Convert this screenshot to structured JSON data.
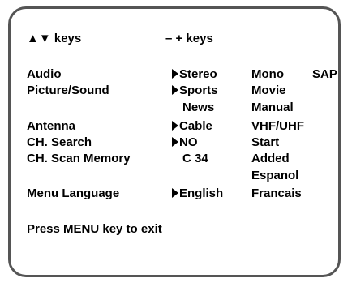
{
  "legend": {
    "updown_keys": "▲▼ keys",
    "plusminus_keys": "– + keys"
  },
  "menu": [
    {
      "id": "audio",
      "label": "Audio",
      "selected": "Stereo",
      "options": [
        "Mono",
        "SAP"
      ]
    },
    {
      "id": "picture-sound",
      "label": "Picture/Sound",
      "selected": "Sports",
      "options": [
        "Movie",
        "News",
        "Manual"
      ]
    },
    {
      "id": "antenna",
      "label": "Antenna",
      "selected": "Cable",
      "options": [
        "VHF/UHF"
      ]
    },
    {
      "id": "ch-search",
      "label": "CH. Search",
      "selected": "NO",
      "options": [
        "Start"
      ]
    },
    {
      "id": "ch-scan-memory",
      "label": "CH. Scan Memory",
      "selected": "C 34",
      "options": [
        "Added"
      ]
    },
    {
      "id": "menu-language",
      "label": "Menu Language",
      "selected": "English",
      "options": [
        "Espanol",
        "Francais"
      ]
    }
  ],
  "footer": {
    "exit_hint": "Press MENU key to exit"
  }
}
